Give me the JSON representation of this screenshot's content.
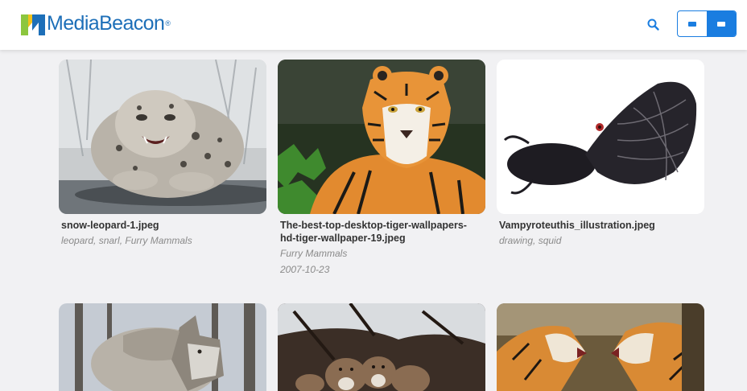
{
  "header": {
    "logo_text": "MediaBeacon",
    "logo_reg": "®",
    "search_icon": "search-icon",
    "view_toggle": {
      "options": [
        "compact-view",
        "grid-view"
      ],
      "active": "grid-view"
    },
    "accent_color": "#1a7de0",
    "brand_color": "#1d6fb8"
  },
  "assets": [
    {
      "filename": "snow-leopard-1.jpeg",
      "tags": "leopard, snarl, Furry Mammals",
      "date": ""
    },
    {
      "filename": "The-best-top-desktop-tiger-wallpapers-hd-tiger-wallpaper-19.jpeg",
      "tags": "Furry Mammals",
      "date": "2007-10-23"
    },
    {
      "filename": "Vampyroteuthis_illustration.jpeg",
      "tags": "drawing, squid",
      "date": ""
    },
    {
      "filename": "",
      "tags": "",
      "date": ""
    },
    {
      "filename": "",
      "tags": "",
      "date": ""
    },
    {
      "filename": "",
      "tags": "",
      "date": ""
    }
  ]
}
